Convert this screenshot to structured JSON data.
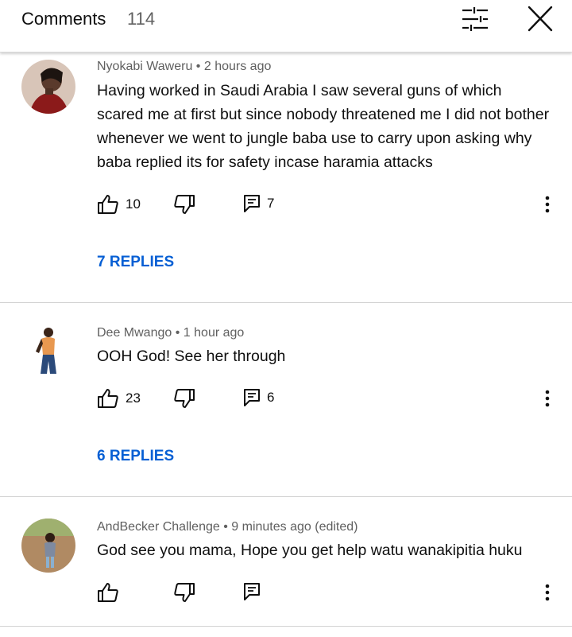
{
  "header": {
    "title": "Comments",
    "count": "114",
    "filter_icon": "sliders-icon",
    "close_icon": "close-icon"
  },
  "comments": [
    {
      "author": "Nyokabi Waweru",
      "time": "2 hours ago",
      "text": "Having worked in Saudi Arabia I saw several guns of which scared me at first but since nobody threatened me I did not bother whenever we went to jungle baba use to carry upon asking why baba replied its for safety incase haramia attacks",
      "likes": "10",
      "replies_count": "7",
      "replies_label": "7 REPLIES"
    },
    {
      "author": "Dee Mwango",
      "time": "1 hour ago",
      "text": "OOH God! See her through",
      "likes": "23",
      "replies_count": "6",
      "replies_label": "6 REPLIES"
    },
    {
      "author": "AndBecker Challenge",
      "time": "9 minutes ago (edited)",
      "text": "God see you mama, Hope you get help watu wanakipitia huku",
      "likes": "",
      "replies_count": ""
    }
  ],
  "separator": "•",
  "colors": {
    "link": "#065fd4",
    "meta": "#606060",
    "text": "#0f0f0f"
  }
}
